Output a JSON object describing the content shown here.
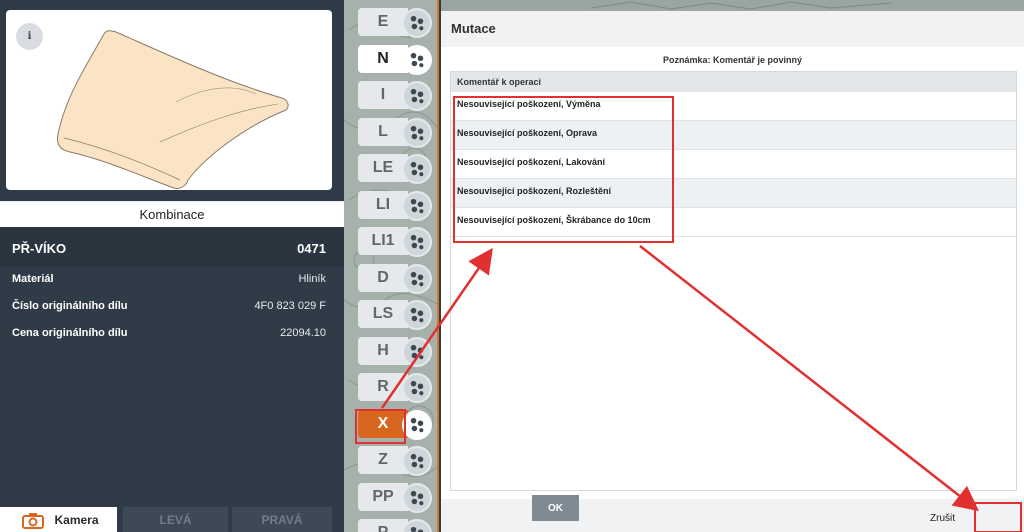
{
  "left_panel": {
    "info_icon": "i",
    "combination_label": "Kombinace",
    "part_name": "PŘ-VÍKO",
    "part_code": "0471",
    "properties": [
      {
        "key": "Materiál",
        "value": "Hliník"
      },
      {
        "key": "Číslo originálního dílu",
        "value": "4F0 823 029 F"
      },
      {
        "key": "Cena originálního dílu",
        "value": "22094.10"
      }
    ],
    "tabs": {
      "camera": "Kamera",
      "left": "LEVÁ",
      "right": "PRAVÁ"
    }
  },
  "operations": [
    {
      "label": "E",
      "state": "normal"
    },
    {
      "label": "N",
      "state": "active"
    },
    {
      "label": "I",
      "state": "normal"
    },
    {
      "label": "L",
      "state": "normal"
    },
    {
      "label": "LE",
      "state": "normal"
    },
    {
      "label": "LI",
      "state": "normal"
    },
    {
      "label": "LI1",
      "state": "normal"
    },
    {
      "label": "D",
      "state": "normal"
    },
    {
      "label": "LS",
      "state": "normal"
    },
    {
      "label": "H",
      "state": "normal"
    },
    {
      "label": "R",
      "state": "normal"
    },
    {
      "label": "X",
      "state": "selected"
    },
    {
      "label": "Z",
      "state": "normal"
    },
    {
      "label": "PP",
      "state": "normal"
    },
    {
      "label": "P",
      "state": "normal"
    }
  ],
  "dialog": {
    "title": "Mutace",
    "note": "Poznámka: Komentář je povinný",
    "column_header": "Komentář k operaci",
    "rows": [
      "Nesouvisející poškození, Výměna",
      "Nesouvisející poškození, Oprava",
      "Nesouvisející poškození, Lakování",
      "Nesouvisející poškození, Rozleštění",
      "Nesouvisející poškození, Škrábance do 10cm"
    ],
    "cancel_label": "Zrušit",
    "ok_label": "OK"
  },
  "colors": {
    "accent_orange": "#d9661f",
    "annotation_red": "#e03030",
    "panel_dark": "#2f3b46"
  }
}
